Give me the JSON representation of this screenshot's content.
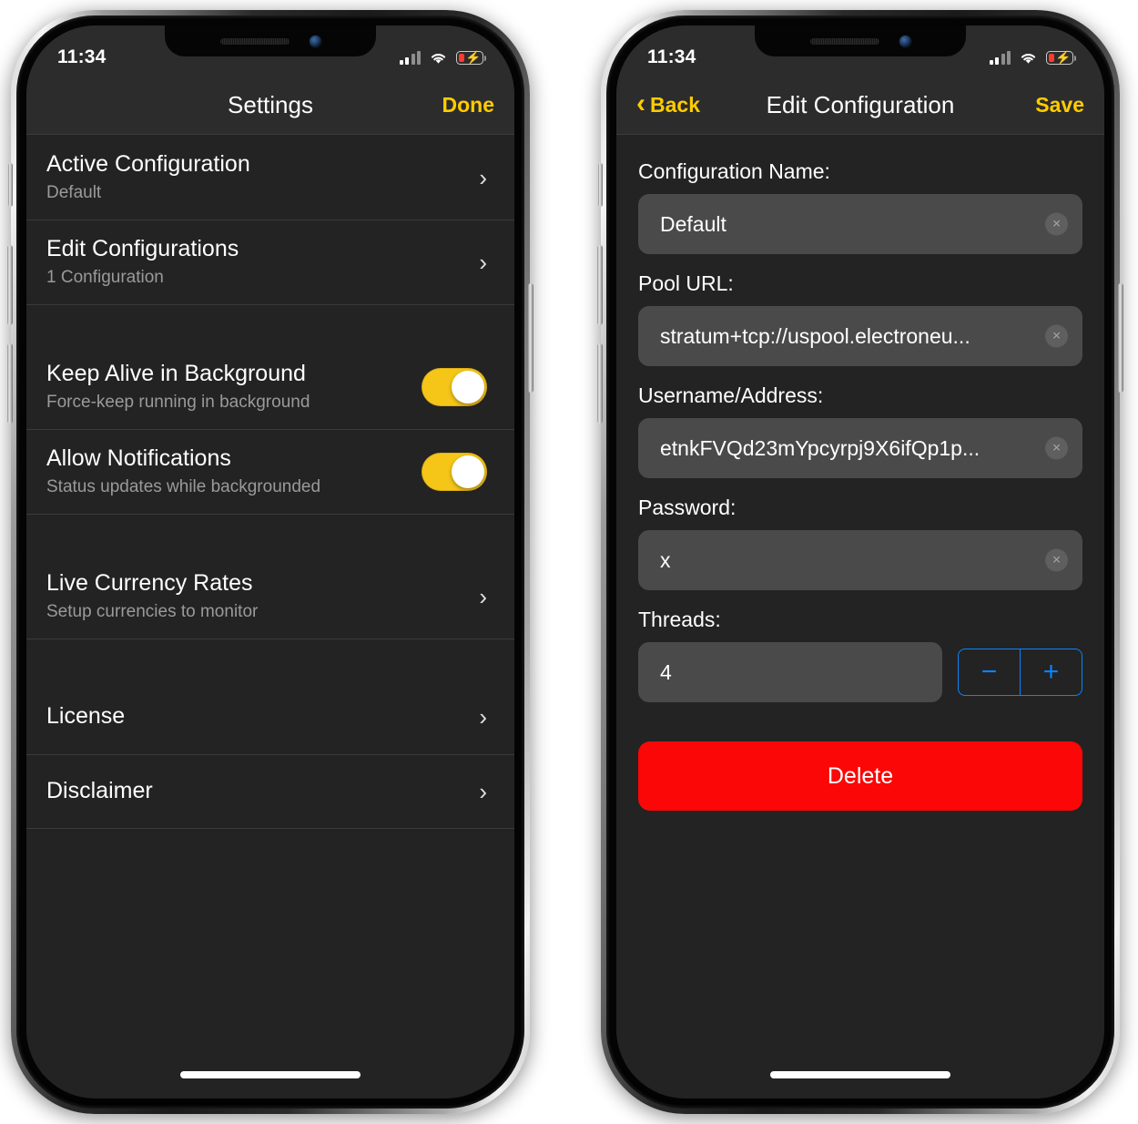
{
  "status_bar": {
    "time": "11:34",
    "battery_charging": true,
    "battery_low": true,
    "signal_bars_filled": 2,
    "signal_bars_total": 4
  },
  "colors": {
    "accent_yellow": "#ffcc00",
    "toggle_on": "#f5c518",
    "stepper_blue": "#0a84ff",
    "delete_red": "#fb0707",
    "screen_bg": "#232323",
    "nav_bg": "#2c2c2c",
    "field_bg": "#4a4a4a"
  },
  "settings_screen": {
    "nav": {
      "title": "Settings",
      "right_button": "Done"
    },
    "sections": [
      {
        "rows": [
          {
            "title": "Active Configuration",
            "subtitle": "Default",
            "accessory": "chevron"
          },
          {
            "title": "Edit Configurations",
            "subtitle": "1 Configuration",
            "accessory": "chevron"
          }
        ]
      },
      {
        "rows": [
          {
            "title": "Keep Alive in Background",
            "subtitle": "Force-keep running in background",
            "accessory": "toggle",
            "toggle_on": true
          },
          {
            "title": "Allow Notifications",
            "subtitle": "Status updates while backgrounded",
            "accessory": "toggle",
            "toggle_on": true
          }
        ]
      },
      {
        "rows": [
          {
            "title": "Live Currency Rates",
            "subtitle": "Setup currencies to monitor",
            "accessory": "chevron"
          }
        ]
      },
      {
        "rows": [
          {
            "title": "License",
            "subtitle": "",
            "accessory": "chevron"
          },
          {
            "title": "Disclaimer",
            "subtitle": "",
            "accessory": "chevron"
          }
        ]
      }
    ]
  },
  "edit_screen": {
    "nav": {
      "back_button": "Back",
      "back_chevron": "‹",
      "title": "Edit Configuration",
      "right_button": "Save"
    },
    "fields": [
      {
        "label": "Configuration Name:",
        "value": "Default",
        "clear_icon": "×"
      },
      {
        "label": "Pool URL:",
        "value": "stratum+tcp://uspool.electroneu...",
        "clear_icon": "×"
      },
      {
        "label": "Username/Address:",
        "value": "etnkFVQd23mYpcyrpj9X6ifQp1p...",
        "clear_icon": "×"
      },
      {
        "label": "Password:",
        "value": "x",
        "clear_icon": "×"
      }
    ],
    "threads": {
      "label": "Threads:",
      "value": "4",
      "decrement_label": "−",
      "increment_label": "+"
    },
    "delete_button": "Delete"
  }
}
